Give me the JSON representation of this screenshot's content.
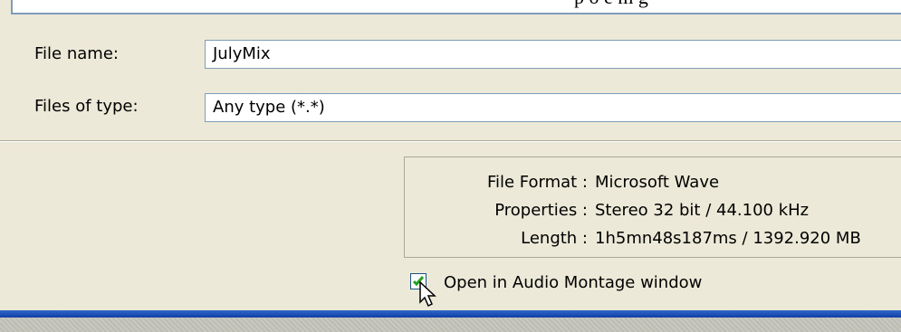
{
  "list_overflow_text": "p o e m g",
  "file_name": {
    "label": "File name:",
    "value": "JulyMix"
  },
  "file_type": {
    "label": "Files of type:",
    "value": "Any type (*.*)"
  },
  "info": {
    "rows": [
      {
        "key": "File Format :",
        "value": "Microsoft Wave"
      },
      {
        "key": "Properties :",
        "value": "Stereo 32 bit / 44.100 kHz"
      },
      {
        "key": "Length :",
        "value": "1h5mn48s187ms / 1392.920 MB"
      }
    ]
  },
  "open_montage": {
    "label": "Open in Audio Montage window",
    "checked": true
  },
  "colors": {
    "accent_bar": "#1f4fb8",
    "dialog_bg": "#ece9d8",
    "field_border": "#7f9db9"
  },
  "icons": [
    "checkmark-icon",
    "mouse-pointer-icon"
  ]
}
